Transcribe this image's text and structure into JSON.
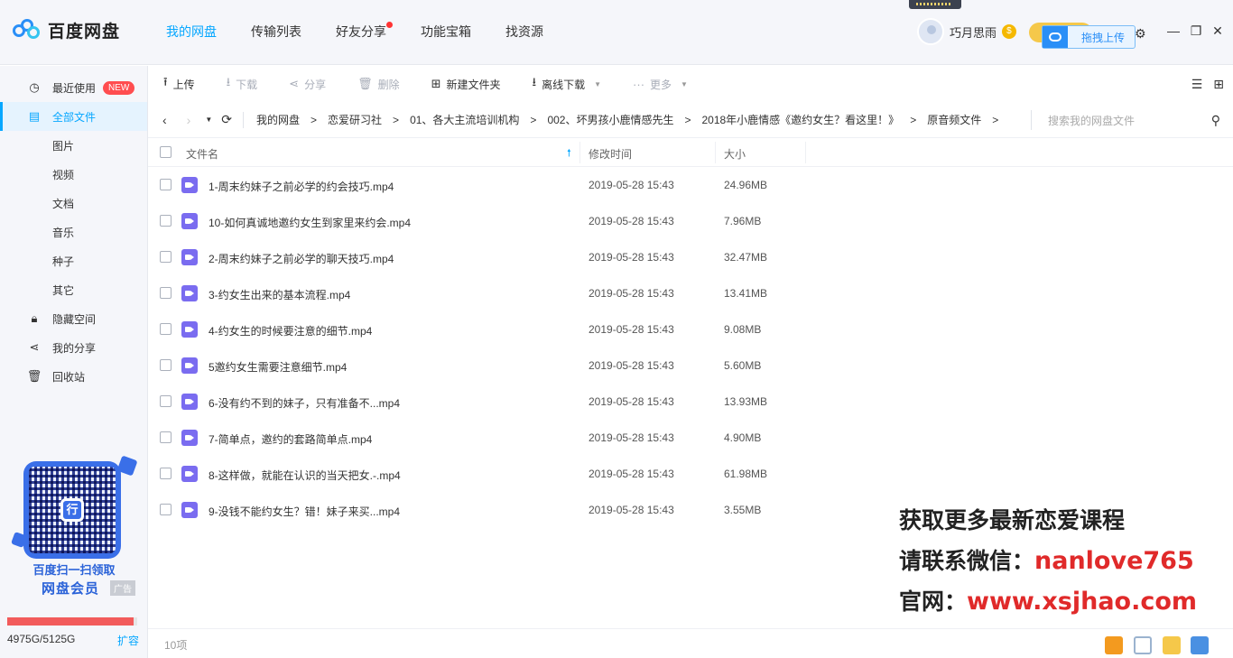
{
  "app": {
    "name": "百度网盘"
  },
  "topnav": [
    {
      "label": "我的网盘",
      "active": true
    },
    {
      "label": "传输列表"
    },
    {
      "label": "好友分享",
      "dot": true
    },
    {
      "label": "功能宝箱"
    },
    {
      "label": "找资源"
    }
  ],
  "user": {
    "name": "巧月思雨",
    "coin_symbol": "$"
  },
  "drag_upload_label": "拖拽上传",
  "sidebar": {
    "items": [
      {
        "label": "最近使用",
        "badge": "NEW",
        "icon": "clock-icon"
      },
      {
        "label": "全部文件",
        "icon": "file-icon",
        "active": true
      },
      {
        "label": "图片",
        "sub": true
      },
      {
        "label": "视频",
        "sub": true
      },
      {
        "label": "文档",
        "sub": true
      },
      {
        "label": "音乐",
        "sub": true
      },
      {
        "label": "种子",
        "sub": true
      },
      {
        "label": "其它",
        "sub": true
      },
      {
        "label": "隐藏空间",
        "icon": "lock-icon"
      },
      {
        "label": "我的分享",
        "icon": "share-icon"
      },
      {
        "label": "回收站",
        "icon": "trash-icon"
      }
    ],
    "qr_center_char": "行",
    "promo_line1": "百度扫一扫领取",
    "promo_line2": "网盘会员",
    "ad_tag": "广告",
    "quota_text": "4975G/5125G",
    "quota_fraction": 0.97,
    "expand_label": "扩容"
  },
  "toolbar": {
    "upload": "上传",
    "download": "下载",
    "share": "分享",
    "delete": "删除",
    "new_folder": "新建文件夹",
    "offline_download": "离线下载",
    "more": "更多"
  },
  "path": {
    "crumbs": [
      "我的网盘",
      "恋爱研习社",
      "01、各大主流培训机构",
      "002、坏男孩小鹿情感先生",
      "2018年小鹿情感《邀约女生？看这里！》",
      "原音频文件"
    ],
    "search_placeholder": "搜索我的网盘文件"
  },
  "table": {
    "col_name": "文件名",
    "col_time": "修改时间",
    "col_size": "大小",
    "rows": [
      {
        "name": "1-周末约妹子之前必学的约会技巧.mp4",
        "time": "2019-05-28 15:43",
        "size": "24.96MB"
      },
      {
        "name": "10-如何真诚地邀约女生到家里来约会.mp4",
        "time": "2019-05-28 15:43",
        "size": "7.96MB"
      },
      {
        "name": "2-周末约妹子之前必学的聊天技巧.mp4",
        "time": "2019-05-28 15:43",
        "size": "32.47MB"
      },
      {
        "name": "3-约女生出来的基本流程.mp4",
        "time": "2019-05-28 15:43",
        "size": "13.41MB"
      },
      {
        "name": "4-约女生的时候要注意的细节.mp4",
        "time": "2019-05-28 15:43",
        "size": "9.08MB"
      },
      {
        "name": "5邀约女生需要注意细节.mp4",
        "time": "2019-05-28 15:43",
        "size": "5.60MB"
      },
      {
        "name": "6-没有约不到的妹子，只有准备不...mp4",
        "time": "2019-05-28 15:43",
        "size": "13.93MB"
      },
      {
        "name": "7-简单点，邀约的套路简单点.mp4",
        "time": "2019-05-28 15:43",
        "size": "4.90MB"
      },
      {
        "name": "8-这样做，就能在认识的当天把女.-.mp4",
        "time": "2019-05-28 15:43",
        "size": "61.98MB"
      },
      {
        "name": "9-没钱不能约女生？错！妹子来买...mp4",
        "time": "2019-05-28 15:43",
        "size": "3.55MB"
      }
    ]
  },
  "watermark": {
    "line1": "获取更多最新恋爱课程",
    "line2_prefix": "请联系微信：",
    "line2_value": "nanlove765",
    "line3_prefix": "官网：",
    "line3_value": "www.xsjhao.com"
  },
  "status": {
    "count": "10项"
  },
  "colors": {
    "accent": "#06a7ff",
    "video_icon": "#7a6cf0",
    "quota_fill": "#f25b5b",
    "watermark_red": "#e02a2a"
  }
}
